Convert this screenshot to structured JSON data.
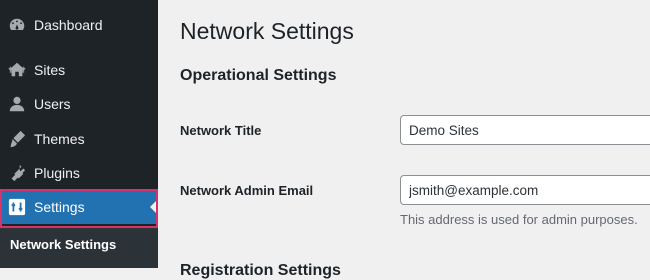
{
  "sidebar": {
    "items": [
      {
        "label": "Dashboard",
        "icon": "dashboard-icon"
      },
      {
        "label": "Sites",
        "icon": "sites-icon"
      },
      {
        "label": "Users",
        "icon": "users-icon"
      },
      {
        "label": "Themes",
        "icon": "themes-icon"
      },
      {
        "label": "Plugins",
        "icon": "plugins-icon"
      },
      {
        "label": "Settings",
        "icon": "settings-icon"
      }
    ],
    "submenu": {
      "label": "Network Settings"
    }
  },
  "main": {
    "page_title": "Network Settings",
    "section_title": "Operational Settings",
    "fields": [
      {
        "label": "Network Title",
        "value": "Demo Sites"
      },
      {
        "label": "Network Admin Email",
        "value": "jsmith@example.com",
        "description": "This address is used for admin purposes."
      }
    ],
    "next_section_partial": "Registration Settings"
  },
  "colors": {
    "sidebar_bg": "#1d2327",
    "active_bg": "#2271b1",
    "highlight_border": "#d6336c",
    "content_bg": "#f0f0f1"
  }
}
